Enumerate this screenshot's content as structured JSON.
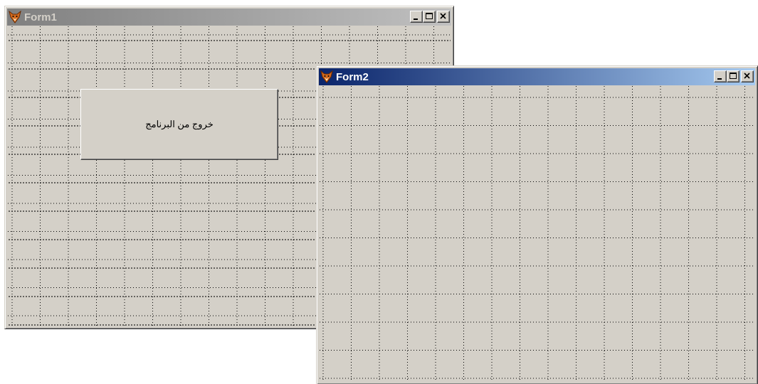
{
  "form1": {
    "title": "Form1",
    "state": "inactive",
    "button_label": "خروج من البرنامج"
  },
  "form2": {
    "title": "Form2",
    "state": "active"
  },
  "icons": {
    "app": "fox-icon",
    "minimize": "minimize-icon",
    "maximize": "maximize-icon",
    "close": "close-icon"
  },
  "colors": {
    "window_face": "#d4d0c8",
    "active_title_start": "#0a246a",
    "active_title_end": "#a6caf0",
    "inactive_title_start": "#808080",
    "inactive_title_end": "#c0c0c0"
  }
}
